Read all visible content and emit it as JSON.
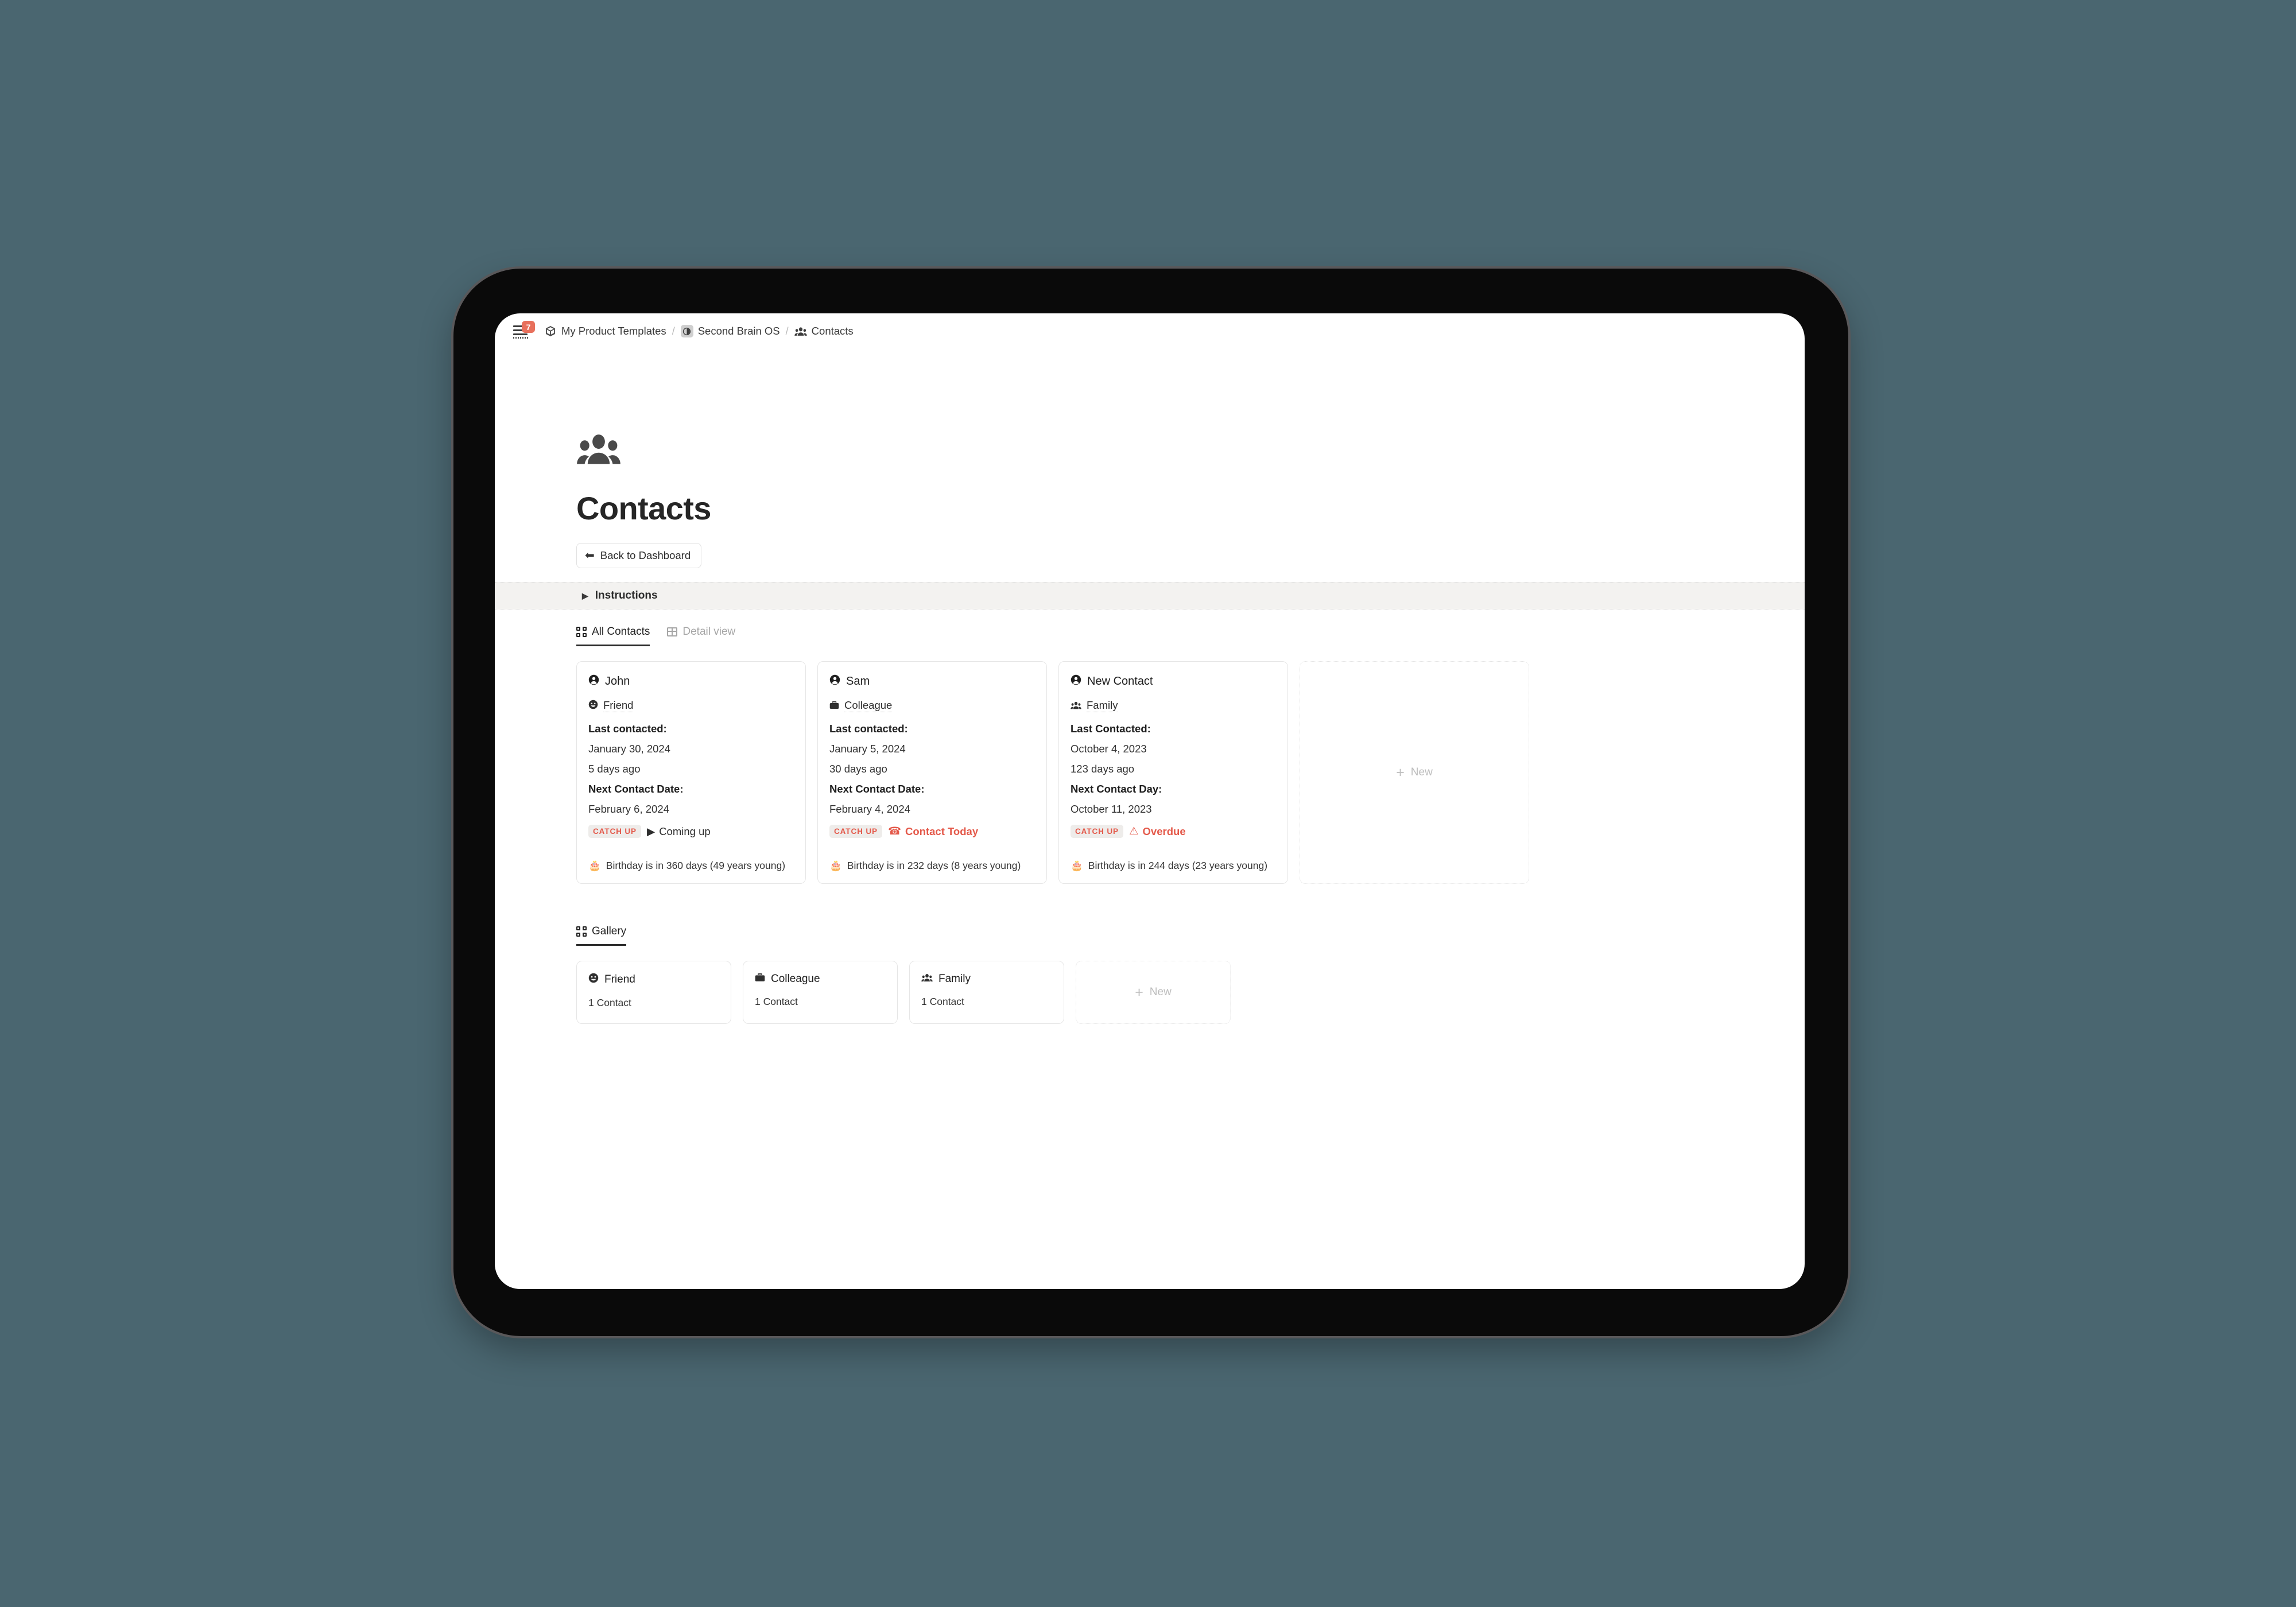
{
  "breadcrumb": {
    "menu_badge_count": "7",
    "items": [
      {
        "icon": "box-cube-icon",
        "label": "My Product Templates"
      },
      {
        "icon": "split-circle-icon",
        "label": "Second Brain OS"
      },
      {
        "icon": "people-icon",
        "label": "Contacts"
      }
    ],
    "separator": "/"
  },
  "page": {
    "icon": "people-icon",
    "title": "Contacts",
    "back_button": {
      "label": "Back to Dashboard",
      "icon": "arrow-left-icon"
    },
    "instructions": {
      "label": "Instructions",
      "toggle_icon": "triangle-right-icon"
    }
  },
  "contacts_view": {
    "tabs": [
      {
        "label": "All Contacts",
        "icon": "grid-icon",
        "active": true
      },
      {
        "label": "Detail view",
        "icon": "table-icon",
        "active": false
      }
    ],
    "new_card_label": "New",
    "cards": [
      {
        "name": "John",
        "name_icon": "person-circle-icon",
        "type": "Friend",
        "type_icon": "smiley-icon",
        "last_contacted_label": "Last contacted:",
        "last_contacted_date": "January 30, 2024",
        "last_contacted_relative": "5 days ago",
        "next_contact_label": "Next Contact Date:",
        "next_contact_date": "February 6, 2024",
        "badge": "CATCH UP",
        "status_text": "Coming up",
        "status_icon": "play-triangle-icon",
        "status_kind": "neutral",
        "birthday": "Birthday is in 360 days (49 years young)",
        "birthday_icon": "birthday-cake-icon"
      },
      {
        "name": "Sam",
        "name_icon": "person-circle-icon",
        "type": "Colleague",
        "type_icon": "briefcase-icon",
        "last_contacted_label": "Last contacted:",
        "last_contacted_date": "January 5, 2024",
        "last_contacted_relative": "30 days ago",
        "next_contact_label": "Next Contact Date:",
        "next_contact_date": "February 4, 2024",
        "badge": "CATCH UP",
        "status_text": "Contact Today",
        "status_icon": "telephone-icon",
        "status_kind": "alert",
        "birthday": "Birthday is in 232 days (8 years young)",
        "birthday_icon": "birthday-cake-icon"
      },
      {
        "name": "New Contact",
        "name_icon": "person-circle-icon",
        "type": "Family",
        "type_icon": "people-icon",
        "last_contacted_label": "Last Contacted:",
        "last_contacted_date": "October 4, 2023",
        "last_contacted_relative": "123 days ago",
        "next_contact_label": "Next Contact Day:",
        "next_contact_date": "October 11, 2023",
        "badge": "CATCH UP",
        "status_text": "Overdue",
        "status_icon": "warning-triangle-icon",
        "status_kind": "alert",
        "birthday": "Birthday is in 244 days (23 years young)",
        "birthday_icon": "birthday-cake-icon"
      }
    ]
  },
  "gallery": {
    "tab": {
      "label": "Gallery",
      "icon": "grid-icon",
      "active": true
    },
    "new_card_label": "New",
    "cards": [
      {
        "title": "Friend",
        "icon": "smiley-icon",
        "count": "1 Contact"
      },
      {
        "title": "Colleague",
        "icon": "briefcase-icon",
        "count": "1 Contact"
      },
      {
        "title": "Family",
        "icon": "people-icon",
        "count": "1 Contact"
      }
    ]
  },
  "colors": {
    "background": "#4a6670",
    "accent_red": "#e4594a",
    "badge_red": "#e8705c",
    "badge_bg": "#eeecea",
    "instructions_bg": "#f3f2f0"
  }
}
